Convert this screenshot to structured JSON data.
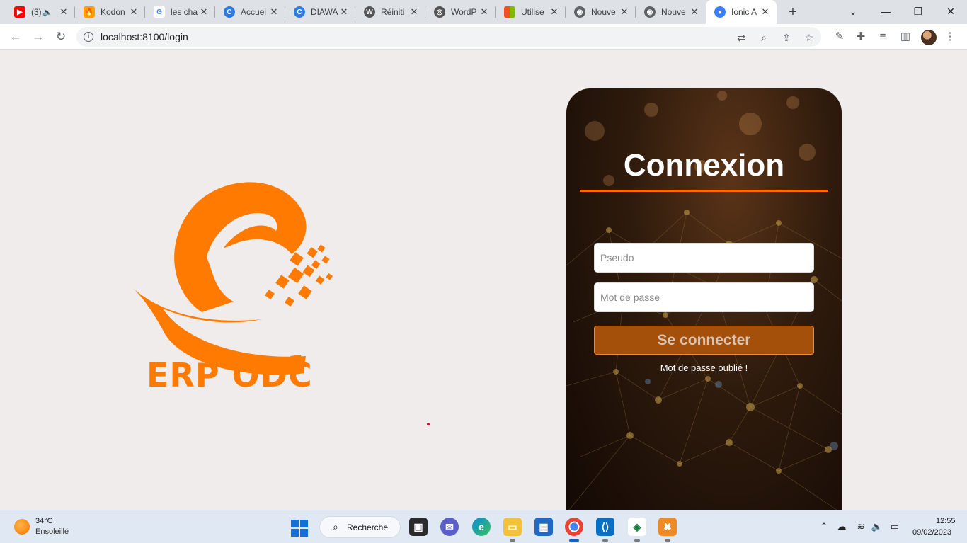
{
  "browser": {
    "tabs": [
      {
        "title": "(3)",
        "icon": "youtube-icon",
        "color": "#ff0000",
        "extra": "audio-icon"
      },
      {
        "title": "Kodon",
        "icon": "firebase-icon",
        "color": "#ffa000"
      },
      {
        "title": "les cha",
        "icon": "google-icon",
        "color": "#4285f4"
      },
      {
        "title": "Accuei",
        "icon": "canva-icon",
        "color": "#2c7be5"
      },
      {
        "title": "DIAWA",
        "icon": "canva-icon",
        "color": "#2c7be5"
      },
      {
        "title": "Réiniti",
        "icon": "wordpress-icon",
        "color": "#555555"
      },
      {
        "title": "WordP",
        "icon": "globe-icon",
        "color": "#555555"
      },
      {
        "title": "Utilise",
        "icon": "microsoft-icon",
        "color": "#f25022"
      },
      {
        "title": "Nouve",
        "icon": "chrome-icon",
        "color": "#5f6368"
      },
      {
        "title": "Nouve",
        "icon": "chrome-icon",
        "color": "#5f6368"
      },
      {
        "title": "Ionic A",
        "icon": "ionic-icon",
        "color": "#3880ff",
        "active": true
      }
    ],
    "new_tab": "+",
    "url": "localhost:8100/login"
  },
  "page": {
    "brand": "ERP ODC",
    "brand_color": "#ff7a00",
    "login": {
      "title": "Connexion",
      "username_placeholder": "Pseudo",
      "password_placeholder": "Mot de passe",
      "submit_label": "Se connecter",
      "forgot_label": "Mot de passe oublié !",
      "accent_color": "#ff6a00"
    }
  },
  "taskbar": {
    "weather": {
      "temp": "34°C",
      "desc": "Ensoleillé"
    },
    "search_label": "Recherche",
    "time": "12:55",
    "date": "09/02/2023"
  }
}
